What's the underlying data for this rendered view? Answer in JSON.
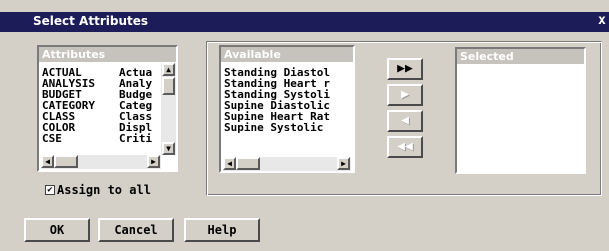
{
  "window": {
    "title": "Select Attributes",
    "close_glyph": "x"
  },
  "attributes_list": {
    "header": "Attributes",
    "rows": [
      {
        "name": "ACTUAL",
        "desc": "Actua"
      },
      {
        "name": "ANALYSIS",
        "desc": "Analy"
      },
      {
        "name": "BUDGET",
        "desc": "Budge"
      },
      {
        "name": "CATEGORY",
        "desc": "Categ"
      },
      {
        "name": "CLASS",
        "desc": "Class"
      },
      {
        "name": "COLOR",
        "desc": "Displ"
      },
      {
        "name": "CSE",
        "desc": "Criti"
      }
    ]
  },
  "available_list": {
    "header": "Available",
    "rows": [
      "Standing Diastol",
      "Standing Heart r",
      "Standing Systoli",
      "Supine Diastolic",
      "Supine Heart Rat",
      "Supine Systolic"
    ]
  },
  "selected_list": {
    "header": "Selected",
    "rows": []
  },
  "move_buttons": {
    "add_all": "▶▶",
    "add": "▶",
    "remove": "◀",
    "remove_all": "◀◀"
  },
  "assign_all": {
    "label": "Assign to all",
    "checked": true,
    "mark": "✔"
  },
  "buttons": {
    "ok": "OK",
    "cancel": "Cancel",
    "help": "Help"
  }
}
